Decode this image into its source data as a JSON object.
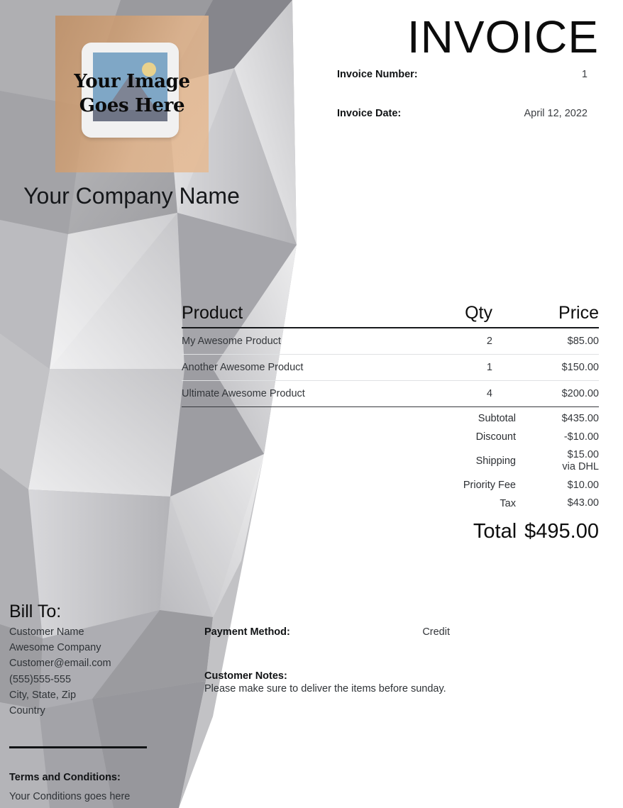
{
  "document": {
    "title": "INVOICE"
  },
  "brand": {
    "logo_caption_line1": "Your Image",
    "logo_caption_line2": "Goes Here",
    "company_name": "Your Company Name",
    "logo_tint_color": "#cf9f74",
    "photo_sky_color": "#7fa7c6",
    "photo_mountain_color": "#7e8494",
    "photo_sun_color": "#e9d18c"
  },
  "meta": {
    "invoice_number_label": "Invoice Number:",
    "invoice_number_value": "1",
    "invoice_date_label": "Invoice Date:",
    "invoice_date_value": "April 12, 2022"
  },
  "products": {
    "headers": {
      "product": "Product",
      "qty": "Qty",
      "price": "Price"
    },
    "rows": [
      {
        "product": "My Awesome Product",
        "qty": "2",
        "price": "$85.00"
      },
      {
        "product": "Another Awesome Product",
        "qty": "1",
        "price": "$150.00"
      },
      {
        "product": "Ultimate Awesome Product",
        "qty": "4",
        "price": "$200.00"
      }
    ]
  },
  "totals": {
    "subtotal_label": "Subtotal",
    "subtotal_value": "$435.00",
    "discount_label": "Discount",
    "discount_value": "-$10.00",
    "shipping_label": "Shipping",
    "shipping_value": "$15.00",
    "shipping_via": "via DHL",
    "priority_fee_label": "Priority Fee",
    "priority_fee_value": "$10.00",
    "tax_label": "Tax",
    "tax_value": "$43.00",
    "total_label": "Total",
    "total_value": "$495.00"
  },
  "bill_to": {
    "heading": "Bill To:",
    "customer_name": "Customer Name",
    "company": "Awesome Company",
    "email": "Customer@email.com",
    "phone": "(555)555-555",
    "city_state_zip": "City, State, Zip",
    "country": "Country"
  },
  "payment": {
    "label": "Payment Method:",
    "value": "Credit"
  },
  "notes": {
    "label": "Customer Notes:",
    "text": "Please make sure to deliver the items before sunday."
  },
  "terms": {
    "label": "Terms and Conditions:",
    "text": "Your Conditions goes here"
  }
}
